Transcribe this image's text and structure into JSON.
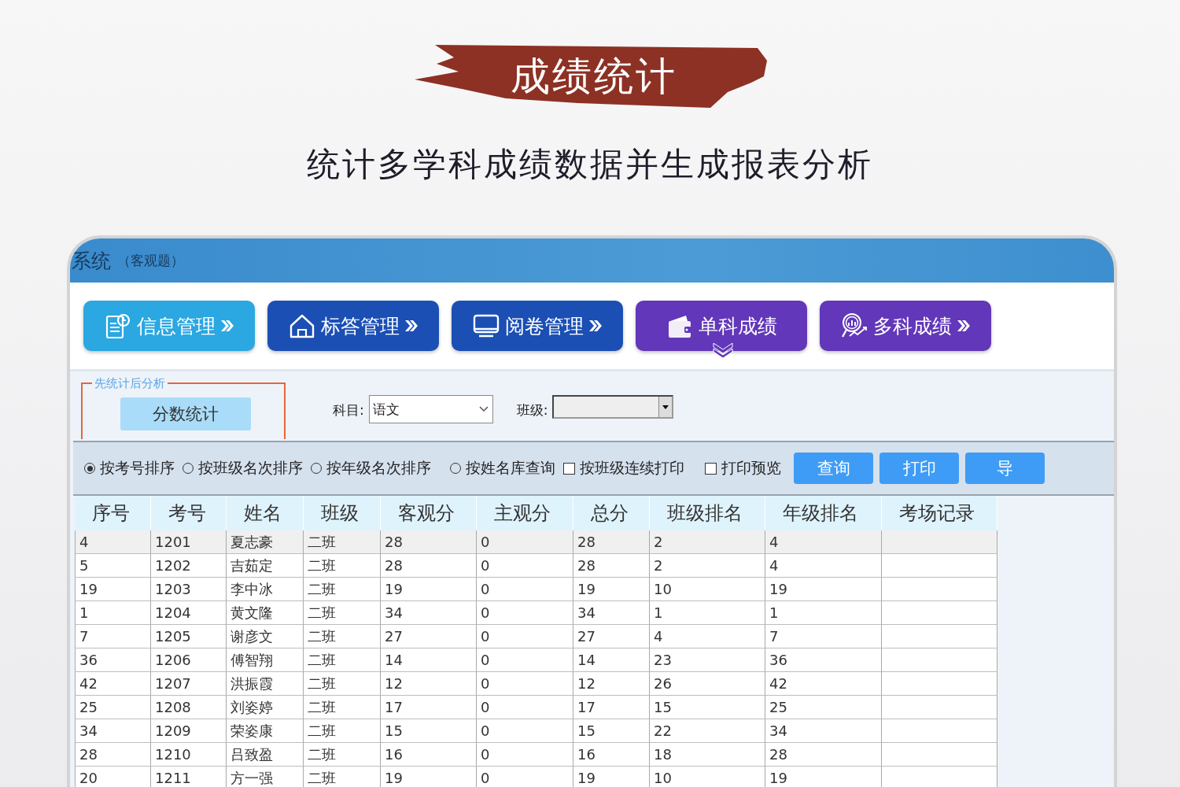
{
  "banner": {
    "title": "成绩统计",
    "subtitle": "统计多学科成绩数据并生成报表分析"
  },
  "window": {
    "title": "系统",
    "title_note": "（客观题）"
  },
  "nav": [
    {
      "label": "信息管理",
      "kind": "document",
      "color": "#2ba7e1",
      "selected": false
    },
    {
      "label": "标答管理",
      "kind": "house",
      "color": "#1b4fb4",
      "selected": false
    },
    {
      "label": "阅卷管理",
      "kind": "monitor",
      "color": "#1b4fb4",
      "selected": false
    },
    {
      "label": "单科成绩",
      "kind": "wallet",
      "color": "#6237b9",
      "selected": true
    },
    {
      "label": "多科成绩",
      "kind": "magnifier",
      "color": "#6237b9",
      "selected": false
    }
  ],
  "group_box": {
    "legend": "先统计后分析",
    "button": "分数统计"
  },
  "filters": {
    "subject": {
      "label": "科目:",
      "value": "语文"
    },
    "class": {
      "label": "班级:"
    }
  },
  "options": [
    {
      "kind": "radio",
      "label": "按考号排序",
      "selected": true
    },
    {
      "kind": "radio",
      "label": "按班级名次排序",
      "selected": false
    },
    {
      "kind": "radio",
      "label": "按年级名次排序",
      "selected": false
    },
    {
      "kind": "radio",
      "label": "按姓名库查询",
      "selected": false
    },
    {
      "kind": "checkbox",
      "label": "按班级连续打印",
      "checked": false
    },
    {
      "kind": "checkbox",
      "label": "打印预览",
      "checked": false
    }
  ],
  "actions": [
    "查询",
    "打印",
    "导"
  ],
  "table": {
    "columns": [
      "序号",
      "考号",
      "姓名",
      "班级",
      "客观分",
      "主观分",
      "总分",
      "班级排名",
      "年级排名",
      "考场记录"
    ],
    "rows": [
      {
        "selected": true,
        "cells": [
          "4",
          "1201",
          "夏志豪",
          "二班",
          "28",
          "0",
          "28",
          "2",
          "4"
        ]
      },
      {
        "selected": false,
        "cells": [
          "5",
          "1202",
          "吉茹定",
          "二班",
          "28",
          "0",
          "28",
          "2",
          "4"
        ]
      },
      {
        "selected": false,
        "cells": [
          "19",
          "1203",
          "李中冰",
          "二班",
          "19",
          "0",
          "19",
          "10",
          "19"
        ]
      },
      {
        "selected": false,
        "cells": [
          "1",
          "1204",
          "黄文隆",
          "二班",
          "34",
          "0",
          "34",
          "1",
          "1"
        ]
      },
      {
        "selected": false,
        "cells": [
          "7",
          "1205",
          "谢彦文",
          "二班",
          "27",
          "0",
          "27",
          "4",
          "7"
        ]
      },
      {
        "selected": false,
        "cells": [
          "36",
          "1206",
          "傅智翔",
          "二班",
          "14",
          "0",
          "14",
          "23",
          "36"
        ]
      },
      {
        "selected": false,
        "cells": [
          "42",
          "1207",
          "洪振霞",
          "二班",
          "12",
          "0",
          "12",
          "26",
          "42"
        ]
      },
      {
        "selected": false,
        "cells": [
          "25",
          "1208",
          "刘姿婷",
          "二班",
          "17",
          "0",
          "17",
          "15",
          "25"
        ]
      },
      {
        "selected": false,
        "cells": [
          "34",
          "1209",
          "荣姿康",
          "二班",
          "15",
          "0",
          "15",
          "22",
          "34"
        ]
      },
      {
        "selected": false,
        "cells": [
          "28",
          "1210",
          "吕致盈",
          "二班",
          "16",
          "0",
          "16",
          "18",
          "28"
        ]
      },
      {
        "selected": false,
        "cells": [
          "20",
          "1211",
          "方一强",
          "二班",
          "19",
          "0",
          "19",
          "10",
          "19"
        ]
      }
    ]
  }
}
